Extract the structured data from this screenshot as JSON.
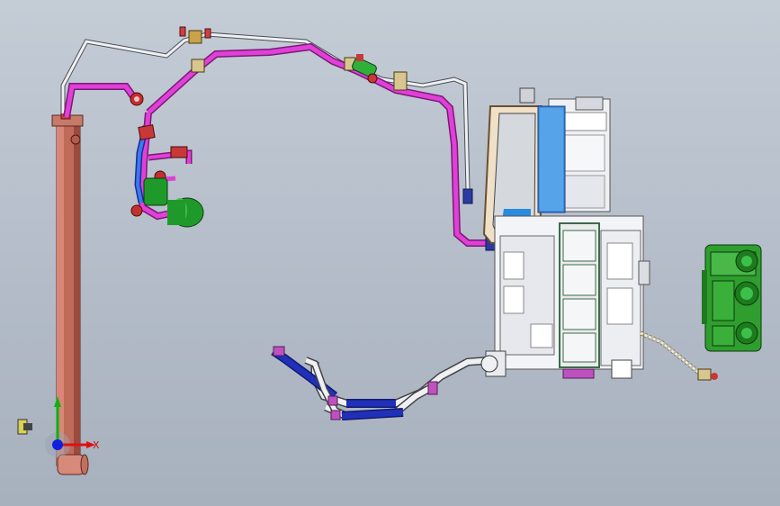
{
  "viewport": {
    "background_top": "#c4ccd6",
    "background_bottom": "#a7b0bd"
  },
  "triad": {
    "x_label": "X",
    "x_color": "#e01010",
    "y_color": "#10b010",
    "z_color": "#1020e0"
  },
  "colors": {
    "refrigerant_line": "#e040d8",
    "aluminum_tube": "#e8eaee",
    "condenser_core": "#c06a5a",
    "receiver_dryer": "#1f9a2a",
    "heater_hose": "#2030b8",
    "hvac_case": "#eef0f4",
    "evaporator_blue": "#2a8ae0",
    "blower_module": "#2f9e2f"
  },
  "components": [
    "condenser",
    "receiver-dryer",
    "refrigerant-lines",
    "expansion-valve",
    "hvac-module",
    "heater-hoses",
    "blower-control-module"
  ]
}
